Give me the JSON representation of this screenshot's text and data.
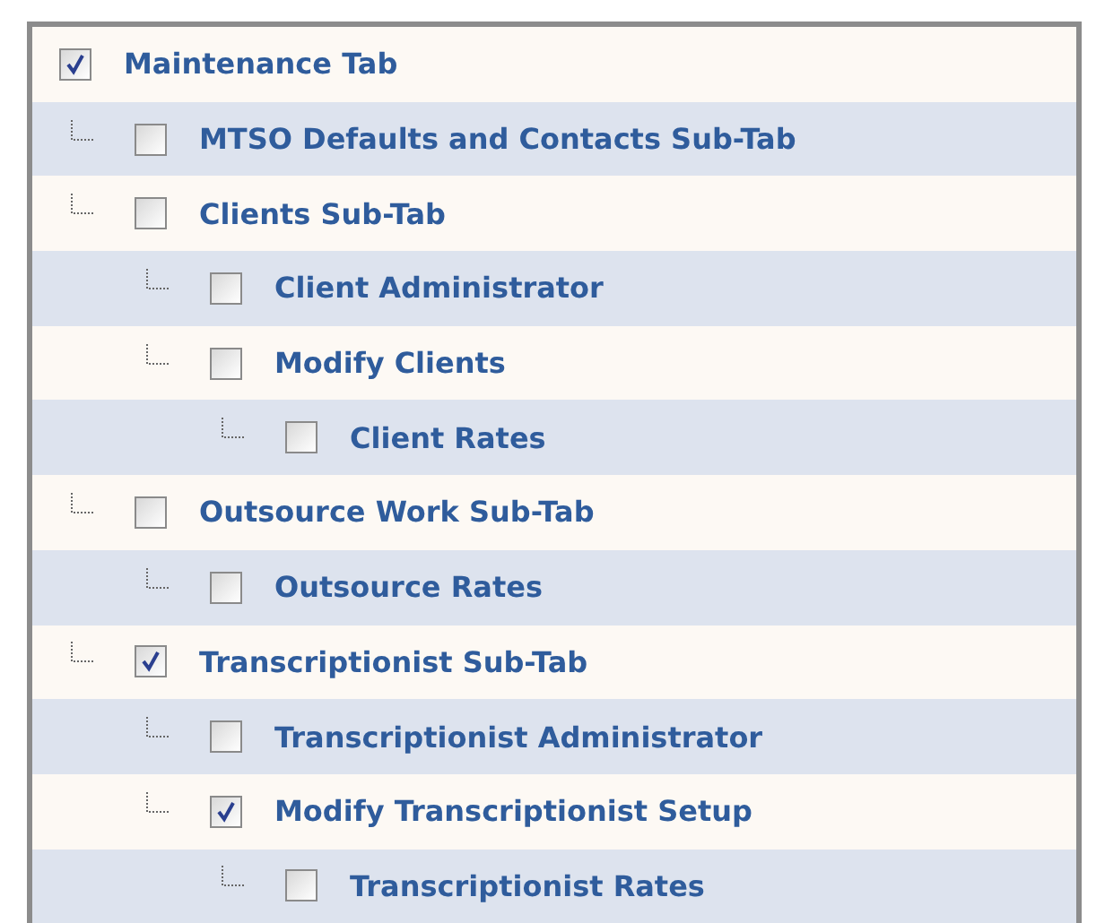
{
  "tree": [
    {
      "label": "Maintenance Tab",
      "checked": true,
      "children": [
        {
          "label": "MTSO Defaults and Contacts Sub-Tab",
          "checked": false
        },
        {
          "label": "Clients Sub-Tab",
          "checked": false,
          "children": [
            {
              "label": "Client Administrator",
              "checked": false
            },
            {
              "label": "Modify Clients",
              "checked": false,
              "children": [
                {
                  "label": "Client Rates",
                  "checked": false
                }
              ]
            }
          ]
        },
        {
          "label": "Outsource Work Sub-Tab",
          "checked": false,
          "children": [
            {
              "label": "Outsource Rates",
              "checked": false
            }
          ]
        },
        {
          "label": "Transcriptionist Sub-Tab",
          "checked": true,
          "children": [
            {
              "label": "Transcriptionist Administrator",
              "checked": false
            },
            {
              "label": "Modify Transcriptionist Setup",
              "checked": true,
              "children": [
                {
                  "label": "Transcriptionist Rates",
                  "checked": false
                }
              ]
            }
          ]
        }
      ]
    }
  ]
}
